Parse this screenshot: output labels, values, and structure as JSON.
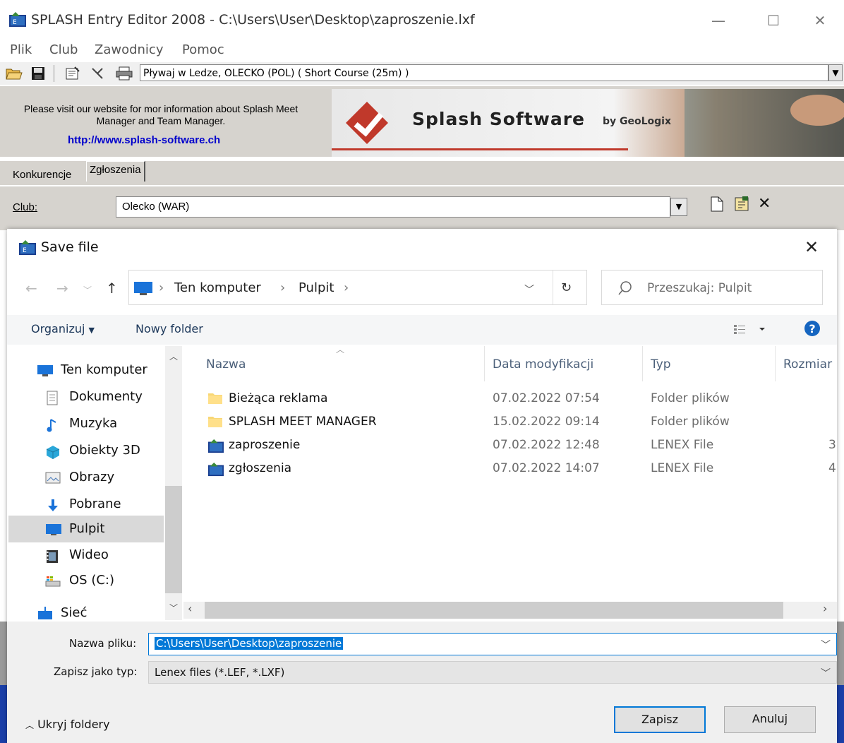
{
  "app": {
    "title": "SPLASH Entry Editor 2008 - C:\\Users\\User\\Desktop\\zaproszenie.lxf",
    "menu": [
      "Plik",
      "Club",
      "Zawodnicy",
      "Pomoc"
    ],
    "meet_select": "Pływaj w Ledze,  OLECKO  (POL)   ( Short Course (25m) )",
    "banner_text": "Please visit our website for mor information about Splash Meet Manager and Team Manager.",
    "banner_link": "http://www.splash-software.ch",
    "banner_brand": "Splash Software",
    "banner_by": "by GeoLogix",
    "tabs": [
      "Konkurencje",
      "Zgłoszenia"
    ],
    "club_label": "Club:",
    "club_value": "Olecko (WAR)"
  },
  "dialog": {
    "title": "Save file",
    "breadcrumb": [
      "Ten komputer",
      "Pulpit"
    ],
    "search_placeholder": "Przeszukaj: Pulpit",
    "organize_label": "Organizuj",
    "new_folder_label": "Nowy folder",
    "nav_items": [
      {
        "label": "Ten komputer",
        "icon": "computer-icon"
      },
      {
        "label": "Dokumenty",
        "icon": "documents-icon"
      },
      {
        "label": "Muzyka",
        "icon": "music-icon"
      },
      {
        "label": "Obiekty 3D",
        "icon": "objects-3d-icon"
      },
      {
        "label": "Obrazy",
        "icon": "pictures-icon"
      },
      {
        "label": "Pobrane",
        "icon": "downloads-icon"
      },
      {
        "label": "Pulpit",
        "icon": "desktop-icon",
        "selected": true
      },
      {
        "label": "Wideo",
        "icon": "video-icon"
      },
      {
        "label": "OS (C:)",
        "icon": "drive-icon"
      },
      {
        "label": "Sieć",
        "icon": "network-icon"
      }
    ],
    "columns": [
      "Nazwa",
      "Data modyfikacji",
      "Typ",
      "Rozmiar"
    ],
    "files": [
      {
        "name": "Bieżąca reklama",
        "date": "07.02.2022 07:54",
        "type": "Folder plików",
        "size": "",
        "icon": "folder-icon"
      },
      {
        "name": "SPLASH MEET MANAGER",
        "date": "15.02.2022 09:14",
        "type": "Folder plików",
        "size": "",
        "icon": "folder-icon"
      },
      {
        "name": "zaproszenie",
        "date": "07.02.2022 12:48",
        "type": "LENEX File",
        "size": "3",
        "icon": "lenex-file-icon"
      },
      {
        "name": "zgłoszenia",
        "date": "07.02.2022 14:07",
        "type": "LENEX File",
        "size": "4",
        "icon": "lenex-file-icon"
      }
    ],
    "filename_label": "Nazwa pliku:",
    "filename_value": "C:\\Users\\User\\Desktop\\zaproszenie",
    "filetype_label": "Zapisz jako typ:",
    "filetype_value": "Lenex files (*.LEF, *.LXF)",
    "hide_folders_label": "Ukryj foldery",
    "save_label": "Zapisz",
    "cancel_label": "Anuluj"
  }
}
